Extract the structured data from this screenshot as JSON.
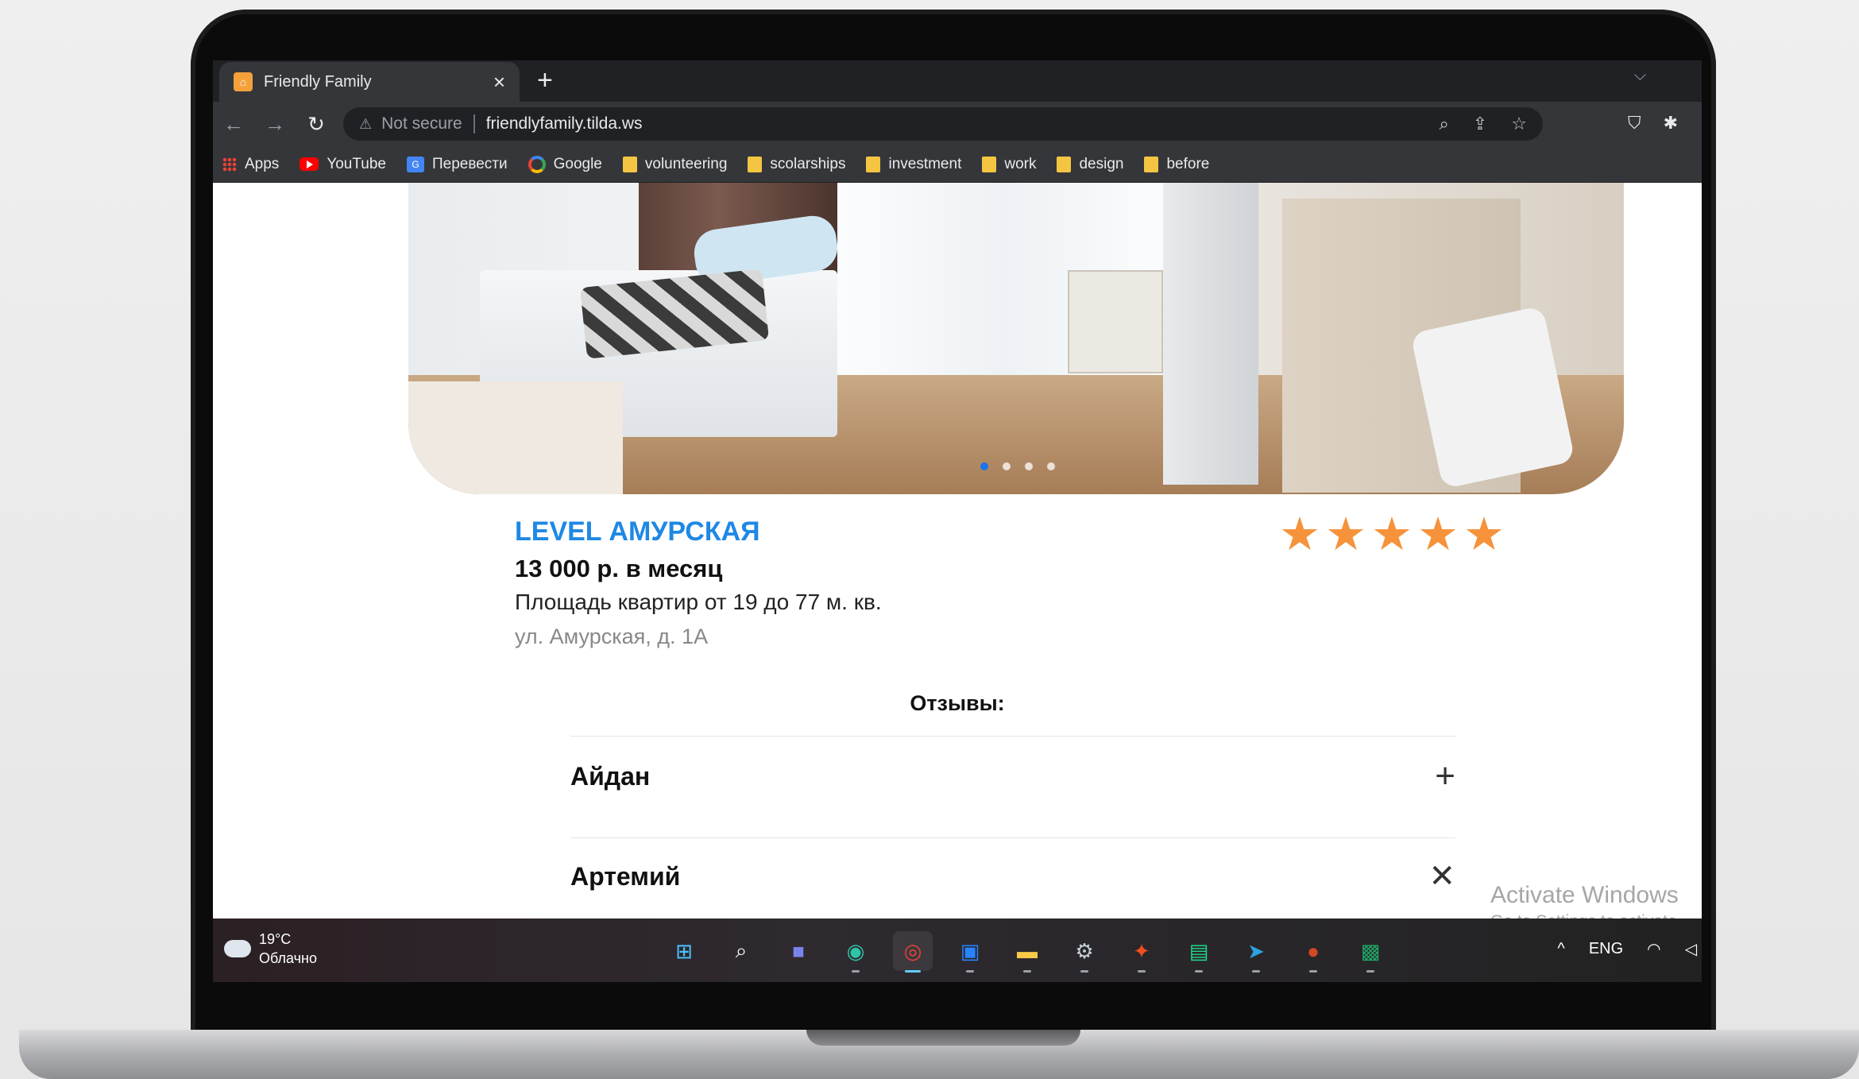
{
  "browser": {
    "tab_title": "Friendly Family",
    "tab_close": "×",
    "new_tab": "+",
    "tab_menu": "⌵",
    "nav": {
      "back": "←",
      "forward": "→",
      "reload": "↻"
    },
    "security_warning": "⚠",
    "security_label": "Not secure",
    "url": "friendlyfamily.tilda.ws",
    "omnibox_icons": [
      "zoom-icon",
      "share-icon",
      "bookmark-star-icon"
    ],
    "bookmarks": [
      {
        "label": "Apps",
        "icon": "apps-grid-icon"
      },
      {
        "label": "YouTube",
        "icon": "youtube-icon"
      },
      {
        "label": "Перевести",
        "icon": "translate-icon"
      },
      {
        "label": "Google",
        "icon": "google-icon"
      },
      {
        "label": "volunteering",
        "icon": "folder-icon"
      },
      {
        "label": "scolarships",
        "icon": "folder-icon"
      },
      {
        "label": "investment",
        "icon": "folder-icon"
      },
      {
        "label": "work",
        "icon": "folder-icon"
      },
      {
        "label": "design",
        "icon": "folder-icon"
      },
      {
        "label": "before",
        "icon": "folder-icon"
      }
    ]
  },
  "listing": {
    "title": "LEVEL АМУРСКАЯ",
    "price": "13 000 р. в месяц",
    "area": "Площадь квартир от 19 до 77 м. кв.",
    "address": "ул. Амурская, д. 1А",
    "rating": {
      "value": 5,
      "max": 5
    },
    "carousel": {
      "slides": 4,
      "active": 1
    },
    "accent_color": "#1e88e5",
    "star_color": "#f5923a"
  },
  "reviews": {
    "heading": "Отзывы:",
    "items": [
      {
        "name": "Айдан",
        "toggle": "+",
        "state": "collapsed"
      },
      {
        "name": "Артемий",
        "toggle": "✕",
        "state": "expanded"
      }
    ]
  },
  "watermark": {
    "line1": "Activate Windows",
    "line2": "Go to Settings to activate"
  },
  "taskbar": {
    "weather_temp": "19°C",
    "weather_desc": "Облачно",
    "apps": [
      "windows-start-icon",
      "search-icon",
      "teams-icon",
      "edge-icon",
      "chrome-icon",
      "trello-icon",
      "file-explorer-icon",
      "settings-icon",
      "figma-icon",
      "pycharm-icon",
      "telegram-icon",
      "powerpoint-icon",
      "excel-icon"
    ],
    "tray_chevron": "^",
    "language": "ENG"
  }
}
